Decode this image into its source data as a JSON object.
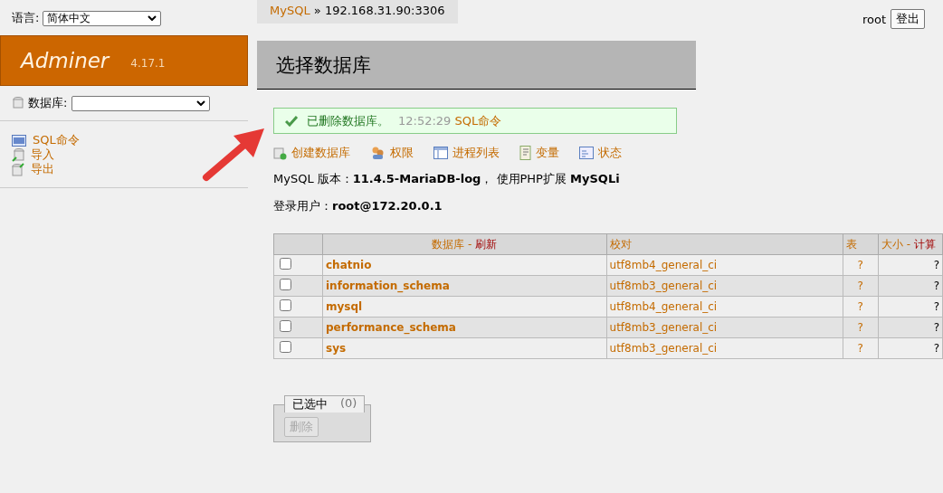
{
  "language": {
    "label": "语言:",
    "value": "简体中文"
  },
  "logo": {
    "name": "Adminer",
    "version": "4.17.1"
  },
  "db_select": {
    "label": "数据库:"
  },
  "sidebar_links": [
    {
      "kind": "sql",
      "label": "SQL命令"
    },
    {
      "kind": "import",
      "label": "导入"
    },
    {
      "kind": "export",
      "label": "导出"
    }
  ],
  "breadcrumb": {
    "link": "MySQL",
    "separator": "»",
    "text": "192.168.31.90:3306"
  },
  "user": {
    "name": "root",
    "logout": "登出"
  },
  "title": "选择数据库",
  "message": {
    "text": "已删除数据库。",
    "time": "12:52:29",
    "link": "SQL命令"
  },
  "actions": [
    {
      "kind": "create",
      "label": "创建数据库"
    },
    {
      "kind": "privileges",
      "label": "权限"
    },
    {
      "kind": "processlist",
      "label": "进程列表"
    },
    {
      "kind": "variables",
      "label": "变量"
    },
    {
      "kind": "status",
      "label": "状态"
    }
  ],
  "info": [
    "MySQL 版本：**11.4.5-MariaDB-log**， 使用PHP扩展 **MySQLi**",
    "登录用户：**root@172.20.0.1**"
  ],
  "table": {
    "columns": [
      {
        "label": "数据库",
        "separator": "-",
        "action": "刷新"
      },
      {
        "label": "校对"
      },
      {
        "label": "表"
      },
      {
        "label": "大小",
        "separator": "-",
        "action": "计算"
      }
    ],
    "rows": [
      {
        "checked": false,
        "name": "chatnio",
        "collation": "utf8mb4_general_ci",
        "tables": "?",
        "size": "?"
      },
      {
        "checked": false,
        "name": "information_schema",
        "collation": "utf8mb3_general_ci",
        "tables": "?",
        "size": "?"
      },
      {
        "checked": false,
        "name": "mysql",
        "collation": "utf8mb4_general_ci",
        "tables": "?",
        "size": "?"
      },
      {
        "checked": false,
        "name": "performance_schema",
        "collation": "utf8mb3_general_ci",
        "tables": "?",
        "size": "?"
      },
      {
        "checked": false,
        "name": "sys",
        "collation": "utf8mb3_general_ci",
        "tables": "?",
        "size": "?"
      }
    ]
  },
  "selection": {
    "legend": "已选中",
    "count": "(0)",
    "button": "删除",
    "disabled": true
  }
}
